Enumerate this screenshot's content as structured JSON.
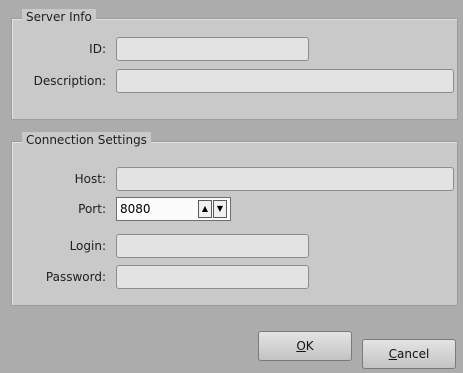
{
  "server_info": {
    "title": "Server Info",
    "id_label": "ID:",
    "id_value": "",
    "description_label": "Description:",
    "description_value": ""
  },
  "connection": {
    "title": "Connection Settings",
    "host_label": "Host:",
    "host_value": "",
    "port_label": "Port:",
    "port_value": "8080",
    "login_label": "Login:",
    "login_value": "",
    "password_label": "Password:",
    "password_value": ""
  },
  "buttons": {
    "ok_mnemonic": "O",
    "ok_rest": "K",
    "cancel_mnemonic": "C",
    "cancel_rest": "ancel"
  }
}
